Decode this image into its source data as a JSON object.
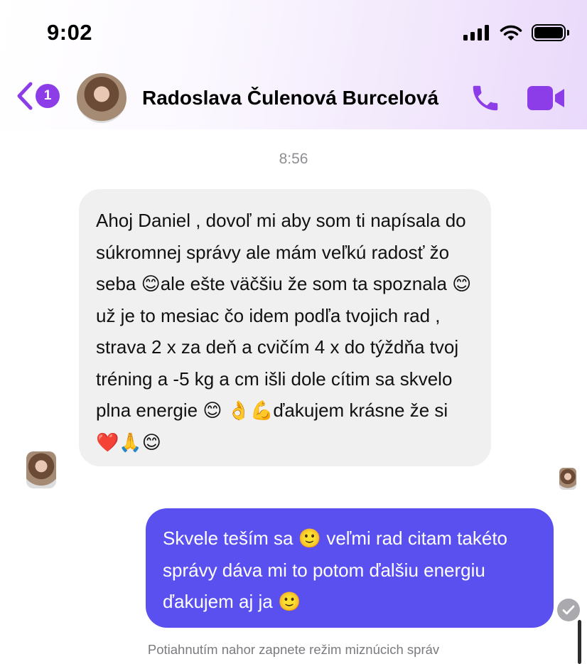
{
  "status_bar": {
    "time": "9:02",
    "icons": [
      "signal-icon",
      "wifi-icon",
      "battery-icon"
    ]
  },
  "header": {
    "back_badge_count": "1",
    "contact_name": "Radoslava Čulenová Burcelová",
    "icons": [
      "back-chevron-icon",
      "phone-icon",
      "video-camera-icon"
    ],
    "accent_color": "#8c3de8"
  },
  "chat": {
    "timestamp": "8:56",
    "incoming_message": "Ahoj Daniel , dovoľ mi aby som ti napísala do súkromnej správy ale mám veľkú radosť žo seba 😊ale ešte väčšiu že som ta spoznala 😊už je to mesiac čo idem podľa tvojich rad , strava 2 x za deň a cvičím  4 x  do týždňa tvoj tréning  a -5 kg a cm išli dole cítim sa skvelo plna energie 😊 👌💪ďakujem krásne že si ❤️🙏😊",
    "outgoing_message": "Skvele teším sa 🙂 veľmi rad citam takéto správy dáva mi to potom ďalšiu energiu ďakujem aj ja 🙂",
    "incoming_bubble_color": "#f0f0f0",
    "outgoing_bubble_color": "#5a50ef"
  },
  "footer": {
    "vanish_mode_hint": "Potiahnutím nahor zapnete režim miznúcich správ"
  }
}
